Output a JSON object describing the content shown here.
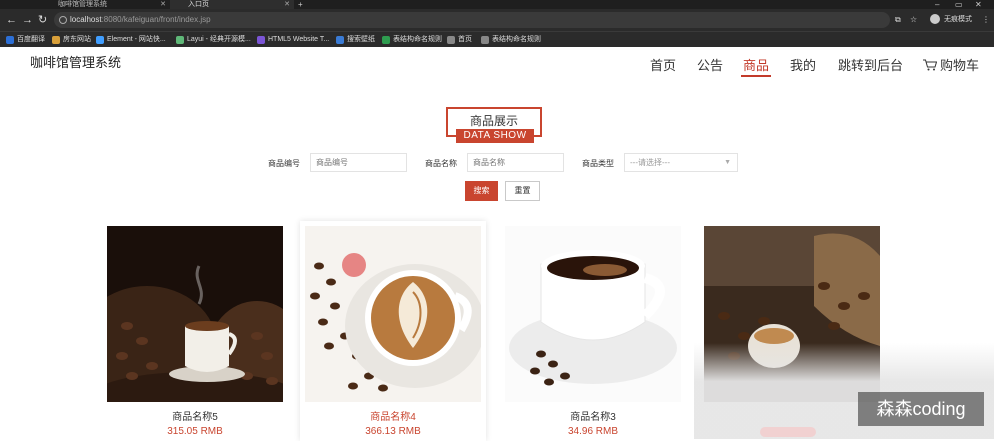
{
  "browser": {
    "tabs": [
      {
        "label": "咖啡馆管理系统"
      },
      {
        "label": "入口页"
      }
    ],
    "url": {
      "host": "localhost",
      "path": ":8080/kafeiguan/front/index.jsp"
    },
    "incognito_label": "无痕模式",
    "bookmarks": [
      {
        "label": "百度翻译",
        "color": "#2c6fd6"
      },
      {
        "label": "房东网站",
        "color": "#d9a03a"
      },
      {
        "label": "Element - 网站快...",
        "color": "#409eff"
      },
      {
        "label": "Layui - 经典开源模...",
        "color": "#5fb878"
      },
      {
        "label": "HTML5 Website T...",
        "color": "#7b55d6"
      },
      {
        "label": "搜索壁纸",
        "color": "#3a7bd5"
      },
      {
        "label": "表结构命名规则",
        "color": "#2e9c4f"
      },
      {
        "label": "首页",
        "color": "#888888"
      },
      {
        "label": "表结构命名规则",
        "color": "#888888"
      }
    ]
  },
  "site": {
    "brand": "咖啡馆管理系统",
    "menu": [
      {
        "label": "首页"
      },
      {
        "label": "公告"
      },
      {
        "label": "商品"
      },
      {
        "label": "我的"
      },
      {
        "label": "跳转到后台"
      },
      {
        "label": "购物车"
      }
    ],
    "active_menu": "商品",
    "section": {
      "title_cn": "商品展示",
      "title_en": "DATA SHOW"
    },
    "filters": {
      "code_label": "商品编号",
      "code_placeholder": "商品编号",
      "name_label": "商品名称",
      "name_placeholder": "商品名称",
      "type_label": "商品类型",
      "type_selected": "---请选择---"
    },
    "buttons": {
      "search": "搜索",
      "reset": "重置"
    },
    "products": [
      {
        "name": "商品名称5",
        "price": "315.05 RMB"
      },
      {
        "name": "商品名称4",
        "price": "366.13 RMB"
      },
      {
        "name": "商品名称3",
        "price": "34.96 RMB"
      },
      {
        "name": "",
        "price": ""
      }
    ],
    "accent_color": "#c9452f"
  },
  "watermark": "森森coding"
}
